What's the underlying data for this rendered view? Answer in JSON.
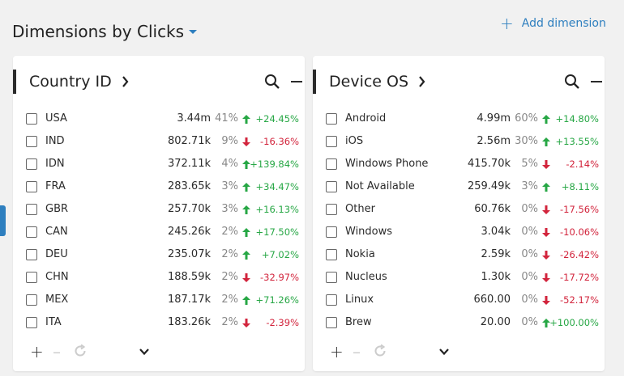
{
  "header": {
    "title_prefix": "Dimensions by",
    "metric": "Clicks",
    "add_dimension": "Add dimension"
  },
  "cards": [
    {
      "title": "Country ID",
      "rows": [
        {
          "name": "USA",
          "value": "3.44m",
          "pct": "41%",
          "dir": "up",
          "change": "+24.45%"
        },
        {
          "name": "IND",
          "value": "802.71k",
          "pct": "9%",
          "dir": "down",
          "change": "-16.36%"
        },
        {
          "name": "IDN",
          "value": "372.11k",
          "pct": "4%",
          "dir": "up",
          "change": "+139.84%"
        },
        {
          "name": "FRA",
          "value": "283.65k",
          "pct": "3%",
          "dir": "up",
          "change": "+34.47%"
        },
        {
          "name": "GBR",
          "value": "257.70k",
          "pct": "3%",
          "dir": "up",
          "change": "+16.13%"
        },
        {
          "name": "CAN",
          "value": "245.26k",
          "pct": "2%",
          "dir": "up",
          "change": "+17.50%"
        },
        {
          "name": "DEU",
          "value": "235.07k",
          "pct": "2%",
          "dir": "up",
          "change": "+7.02%"
        },
        {
          "name": "CHN",
          "value": "188.59k",
          "pct": "2%",
          "dir": "down",
          "change": "-32.97%"
        },
        {
          "name": "MEX",
          "value": "187.17k",
          "pct": "2%",
          "dir": "up",
          "change": "+71.26%"
        },
        {
          "name": "ITA",
          "value": "183.26k",
          "pct": "2%",
          "dir": "down",
          "change": "-2.39%"
        }
      ]
    },
    {
      "title": "Device OS",
      "rows": [
        {
          "name": "Android",
          "value": "4.99m",
          "pct": "60%",
          "dir": "up",
          "change": "+14.80%"
        },
        {
          "name": "iOS",
          "value": "2.56m",
          "pct": "30%",
          "dir": "up",
          "change": "+13.55%"
        },
        {
          "name": "Windows Phone",
          "value": "415.70k",
          "pct": "5%",
          "dir": "down",
          "change": "-2.14%"
        },
        {
          "name": "Not Available",
          "value": "259.49k",
          "pct": "3%",
          "dir": "up",
          "change": "+8.11%"
        },
        {
          "name": "Other",
          "value": "60.76k",
          "pct": "0%",
          "dir": "down",
          "change": "-17.56%"
        },
        {
          "name": "Windows",
          "value": "3.04k",
          "pct": "0%",
          "dir": "down",
          "change": "-10.06%"
        },
        {
          "name": "Nokia",
          "value": "2.59k",
          "pct": "0%",
          "dir": "down",
          "change": "-26.42%"
        },
        {
          "name": "Nucleus",
          "value": "1.30k",
          "pct": "0%",
          "dir": "down",
          "change": "-17.72%"
        },
        {
          "name": "Linux",
          "value": "660.00",
          "pct": "0%",
          "dir": "down",
          "change": "-52.17%"
        },
        {
          "name": "Brew",
          "value": "20.00",
          "pct": "0%",
          "dir": "up",
          "change": "+100.00%"
        }
      ]
    }
  ],
  "colors": {
    "accent": "#2e7fbf",
    "up": "#27a745",
    "down": "#d2243c"
  },
  "icons": {
    "add": "plus-icon",
    "remove": "minus-icon",
    "refresh": "refresh-icon",
    "more": "chevron-down-icon",
    "search": "search-icon",
    "collapse": "minus-icon"
  }
}
